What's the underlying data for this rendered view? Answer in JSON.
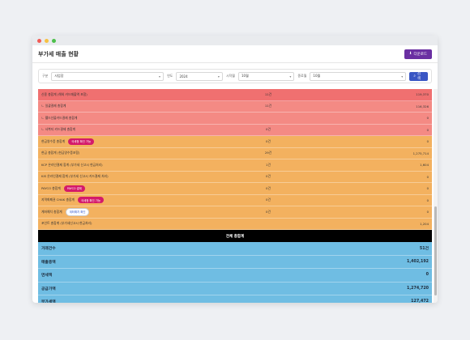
{
  "header": {
    "title": "부가세 매출 현황",
    "export_label": "다운로드"
  },
  "filters": {
    "f1_label": "구분",
    "f1_value": "사업장",
    "f2_label": "연도",
    "f2_value": "2024",
    "f3_label": "시작월",
    "f3_value": "10월",
    "f4_label": "종료월",
    "f4_value": "10월",
    "search_label": "검색"
  },
  "rows": [
    {
      "label": "신용 총합계 (해외 카드매출액 포함)",
      "count": "11건",
      "amount": "119,370",
      "badge": "",
      "badge_style": ""
    },
    {
      "label": "ㄴ 일괄결제 총합계",
      "count": "11건",
      "amount": "116,326",
      "badge": "",
      "badge_style": ""
    },
    {
      "label": "ㄴ 웰드선물카드결제 총합계",
      "count": "",
      "amount": "0",
      "badge": "",
      "badge_style": ""
    },
    {
      "label": "ㄴ 사복지 카드결제 총합계",
      "count": "0건",
      "amount": "0",
      "badge": "",
      "badge_style": ""
    },
    {
      "label": "현금영수증 총합계",
      "count": "0건",
      "amount": "0",
      "badge": "국세청 확인 가능",
      "badge_style": "pink"
    },
    {
      "label": "현금 총합계 (현금영수증포함)",
      "count": "29건",
      "amount": "1,275,714",
      "badge": "",
      "badge_style": ""
    },
    {
      "label": "KCP 온라인결제 합계 (부가세 신고시 현금처리)",
      "count": "1건",
      "amount": "1,604",
      "badge": "",
      "badge_style": ""
    },
    {
      "label": "KIS 온라인결제 합계 (부가세 신고시 카드결제 처리)",
      "count": "0건",
      "amount": "0",
      "badge": "",
      "badge_style": ""
    },
    {
      "label": "PAYCO 총합계",
      "count": "0건",
      "amount": "0",
      "badge": "PAYCO 결제",
      "badge_style": "pink"
    },
    {
      "label": "지역화폐권 CHAK 총합계",
      "count": "0건",
      "amount": "0",
      "badge": "국세청 확인 가능",
      "badge_style": "pink"
    },
    {
      "label": "계좌예치 총합계",
      "count": "0건",
      "amount": "0",
      "badge": "계좌예치 확인",
      "badge_style": "white"
    },
    {
      "label": "포인트 총합계 (부가세신고시 현금처리)",
      "count": "",
      "amount": "1,204",
      "badge": "",
      "badge_style": ""
    }
  ],
  "row_colors": [
    "red1",
    "red2",
    "red2",
    "red2",
    "orange",
    "orange",
    "orange",
    "orange",
    "orange",
    "orange",
    "orange",
    "orange"
  ],
  "total": {
    "title": "전체 총합계",
    "items": [
      {
        "label": "거래건수",
        "value": "51건"
      },
      {
        "label": "매출총액",
        "value": "1,402,192"
      },
      {
        "label": "면세액",
        "value": "0"
      },
      {
        "label": "공급가액",
        "value": "1,274,720"
      },
      {
        "label": "부가세액",
        "value": "127,472"
      }
    ]
  },
  "colors": {
    "accent": "#6a2fa2",
    "search": "#3a56c4",
    "red_row": "#f07070",
    "orange_row": "#f3b15f",
    "summary_row": "#6fbde3"
  }
}
